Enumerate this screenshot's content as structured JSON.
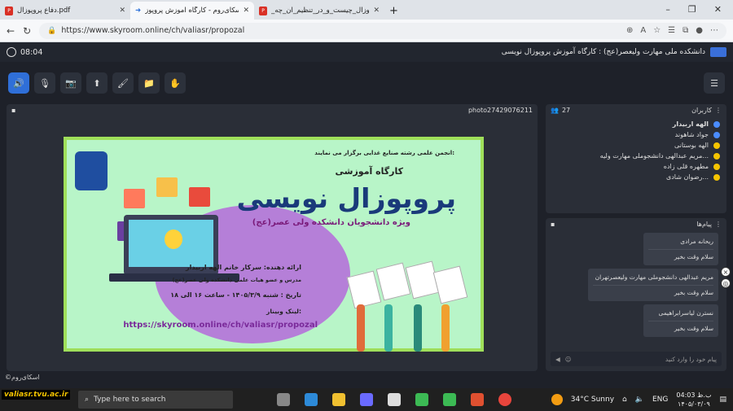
{
  "browser": {
    "tabs": [
      {
        "label": "دفاع پروپوزال.pdf",
        "kind": "pdf",
        "active": false
      },
      {
        "label": "اسکای‌روم - کارگاه آموزش پروپوز",
        "kind": "skyroom",
        "active": true
      },
      {
        "label": "_پروپوزال_چیست_و_در_تنظیم_آن_چه",
        "kind": "pdf",
        "active": false
      }
    ],
    "url": "https://www.skyroom.online/ch/valiasr/propozal",
    "new_tab": "+"
  },
  "app": {
    "time": "08:04",
    "title": "دانشکده ملی مهارت ولیعصر(عج) : کارگاه آموزش پروپوزال نویسی"
  },
  "toolbar": {
    "icons": [
      "speaker-icon",
      "mic-off-icon",
      "camera-off-icon",
      "screen-share-icon",
      "brush-icon",
      "folder-icon",
      "hand-icon"
    ],
    "glyphs": [
      "🔊",
      "🎙",
      "📷",
      "⬆",
      "🖌",
      "📁",
      "✋"
    ]
  },
  "video": {
    "label": "photo27429076211",
    "poster": {
      "top": "انجمن علمی رشته صنایع غذایی برگزار می نمایند:",
      "line1": "کارگاه آموزشی",
      "line2": "پروپوزال نویسی",
      "line3": "ویژه دانشجویان دانشکده ولی عصر(عج)",
      "presenter": "ارائه دهنده: سرکار خانم الهه اربیدار",
      "presenter_role": "مدرس و عضو هیات علمی دانشکده ولی عصر(عج)",
      "date": "تاریخ : شنبه ۱۴۰۵/۳/۹ - ساعت ۱۶ الی ۱۸",
      "link_label": "لینک وبینار:",
      "link": "https://skyroom.online/ch/valiasr/propozal"
    }
  },
  "users": {
    "title": "کاربران",
    "count": "27",
    "list": [
      {
        "name": "الهه اربیدار",
        "color": "#4a8cff"
      },
      {
        "name": "جواد شاهوند",
        "color": "#4a8cff"
      },
      {
        "name": "الهه بوستانی",
        "color": "#f5c400"
      },
      {
        "name": "مریم عبدالهی دانشجوملی مهارت ولیه...",
        "color": "#f5c400"
      },
      {
        "name": "مطهره قلی زاده",
        "color": "#f5c400"
      },
      {
        "name": "رضوان شادی...",
        "color": "#f5c400"
      }
    ]
  },
  "messages": {
    "title": "پیام‌ها",
    "items": [
      {
        "sender": "ریحانه مرادی",
        "text": "سلام وقت بخیر",
        "wide": false
      },
      {
        "sender": "مریم عبدالهی دانشجوملی مهارت ولیعصرتهران",
        "text": "سلام وقت بخیر",
        "wide": true
      },
      {
        "sender": "نسترن لیاسرابراهیمی",
        "text": "سلام وقت بخیر",
        "wide": false
      }
    ],
    "placeholder": "پیام خود را وارد کنید"
  },
  "footer": "©اسکای‌روم",
  "taskbar": {
    "search": "Type here to search",
    "brand": "valiasr.tvu.ac.ir",
    "weather": "34°C Sunny",
    "lang": "ENG",
    "time": "04:03 ب.ظ",
    "date": "۱۴۰۵/۰۳/۰۹"
  }
}
